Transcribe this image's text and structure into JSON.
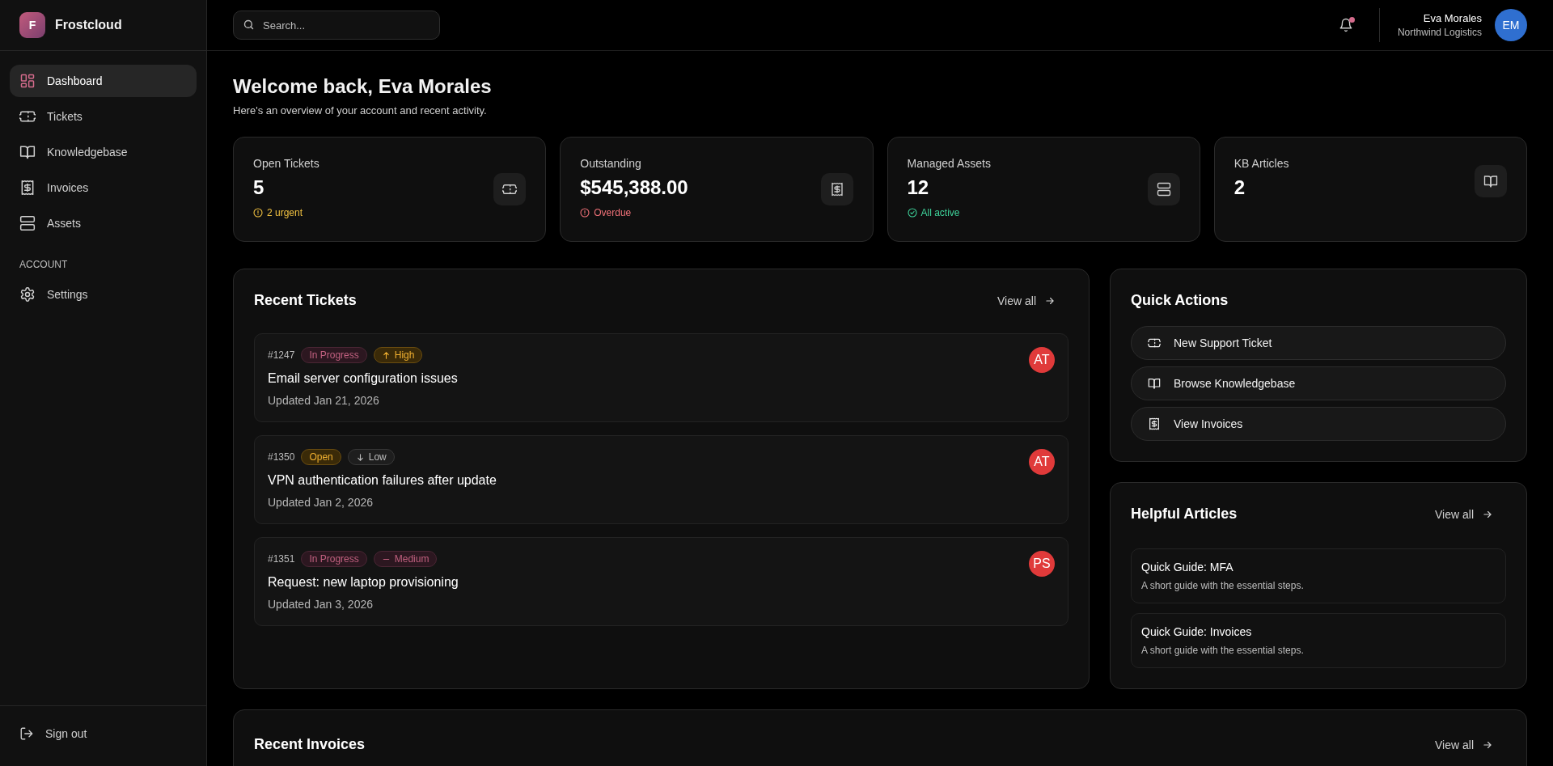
{
  "brand": {
    "initial": "F",
    "name": "Frostcloud"
  },
  "sidebar": {
    "items": [
      {
        "label": "Dashboard",
        "kind": "grid",
        "selected": true
      },
      {
        "label": "Tickets",
        "kind": "ticket",
        "selected": false
      },
      {
        "label": "Knowledgebase",
        "kind": "book",
        "selected": false
      },
      {
        "label": "Invoices",
        "kind": "receipt",
        "selected": false
      },
      {
        "label": "Assets",
        "kind": "server",
        "selected": false
      }
    ],
    "section_label": "ACCOUNT",
    "account_items": [
      {
        "label": "Settings",
        "kind": "gear",
        "selected": false
      }
    ],
    "sign_out": "Sign out"
  },
  "header": {
    "search": {
      "placeholder": "Search..."
    },
    "notification_unread": true,
    "user": {
      "name": "Eva Morales",
      "company": "Northwind Logistics",
      "initials": "EM"
    }
  },
  "welcome": {
    "title": "Welcome back, Eva Morales",
    "subtitle": "Here's an overview of your account and recent activity."
  },
  "stats": [
    {
      "label": "Open Tickets",
      "value": "5",
      "note": "2 urgent",
      "color": "#f0c040",
      "kind": "ticket"
    },
    {
      "label": "Outstanding",
      "value": "$545,388.00",
      "note": "Overdue",
      "color": "#f07178",
      "kind": "receipt"
    },
    {
      "label": "Managed Assets",
      "value": "12",
      "note": "All active",
      "color": "#3ed29a",
      "kind": "server"
    },
    {
      "label": "KB Articles",
      "value": "2",
      "kind": "book"
    }
  ],
  "recent_tickets": {
    "title": "Recent Tickets",
    "view_all": "View all",
    "tickets": [
      {
        "id": "#1247",
        "status": {
          "label": "In Progress",
          "kind": "in-progress"
        },
        "priority": {
          "label": "High",
          "kind": "high"
        },
        "title": "Email server configuration issues",
        "updated": "Updated Jan 21, 2026",
        "assignee": "AT"
      },
      {
        "id": "#1350",
        "status": {
          "label": "Open",
          "kind": "open"
        },
        "priority": {
          "label": "Low",
          "kind": "low"
        },
        "title": "VPN authentication failures after update",
        "updated": "Updated Jan 2, 2026",
        "assignee": "AT"
      },
      {
        "id": "#1351",
        "status": {
          "label": "In Progress",
          "kind": "in-progress"
        },
        "priority": {
          "label": "Medium",
          "kind": "medium"
        },
        "title": "Request: new laptop provisioning",
        "updated": "Updated Jan 3, 2026",
        "assignee": "PS"
      }
    ]
  },
  "quick_actions": {
    "title": "Quick Actions",
    "actions": [
      {
        "label": "New Support Ticket",
        "kind": "ticket"
      },
      {
        "label": "Browse Knowledgebase",
        "kind": "book"
      },
      {
        "label": "View Invoices",
        "kind": "receipt"
      }
    ]
  },
  "helpful_articles": {
    "title": "Helpful Articles",
    "view_all": "View all",
    "articles": [
      {
        "title": "Quick Guide: MFA",
        "summary": "A short guide with the essential steps."
      },
      {
        "title": "Quick Guide: Invoices",
        "summary": "A short guide with the essential steps."
      }
    ]
  },
  "recent_invoices": {
    "title": "Recent Invoices",
    "view_all": "View all"
  }
}
